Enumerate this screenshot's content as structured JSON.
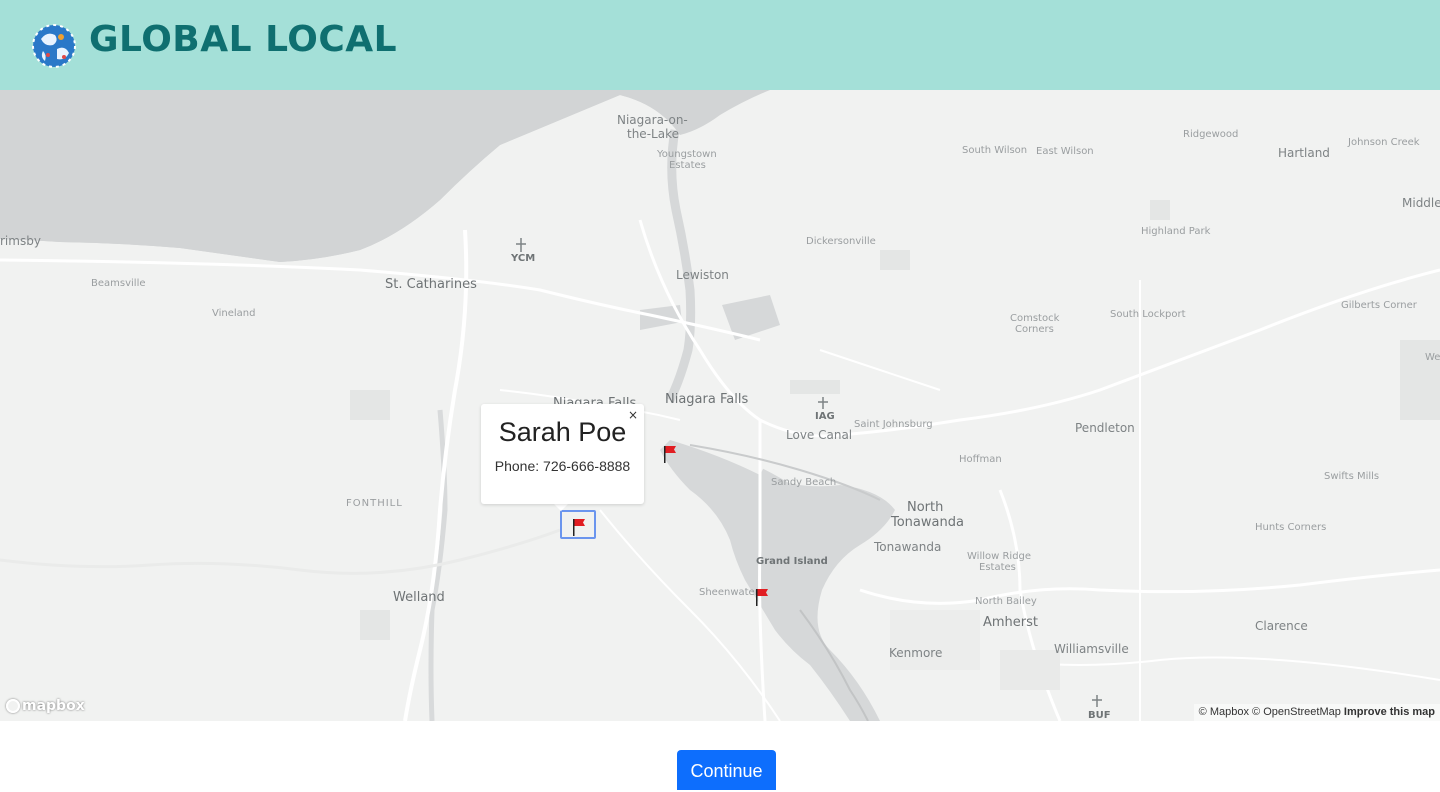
{
  "header": {
    "brand": "GLOBAL LOCAL",
    "logo_icon": "globe-icon",
    "background": "#a4e0d8",
    "brand_color": "#0f6f70"
  },
  "map": {
    "labels": {
      "grimsby": "rimsby",
      "beamsville": "Beamsville",
      "vineland": "Vineland",
      "st_catharines": "St. Catharines",
      "ycm": "YCM",
      "niagara_on_the_lake_1": "Niagara-on-",
      "niagara_on_the_lake_2": "the-Lake",
      "youngstown_1": "Youngstown",
      "youngstown_2": "Estates",
      "lewiston": "Lewiston",
      "niagara_falls_ca": "Niagara Falls",
      "niagara_falls_us": "Niagara Falls",
      "iag": "IAG",
      "love_canal": "Love Canal",
      "saint_johnsburg": "Saint Johnsburg",
      "fonthill": "FONTHILL",
      "welland": "Welland",
      "sandy_beach": "Sandy Beach",
      "grand_island": "Grand Island",
      "sheenwater": "Sheenwater",
      "north_tonawanda_1": "North",
      "north_tonawanda_2": "Tonawanda",
      "tonawanda": "Tonawanda",
      "kenmore": "Kenmore",
      "amherst": "Amherst",
      "williamsville": "Williamsville",
      "buf": "BUF",
      "north_bailey": "North Bailey",
      "willow_ridge_1": "Willow Ridge",
      "willow_ridge_2": "Estates",
      "hoffman": "Hoffman",
      "pendleton": "Pendleton",
      "clarence": "Clarence",
      "hunts_corners": "Hunts Corners",
      "swifts_mills": "Swifts Mills",
      "south_wilson": "South Wilson",
      "east_wilson": "East Wilson",
      "ridgewood": "Ridgewood",
      "hartland": "Hartland",
      "johnson_creek": "Johnson Creek",
      "middle": "Middle",
      "dickersonville": "Dickersonville",
      "highland_park": "Highland Park",
      "comstock_1": "Comstock",
      "comstock_2": "Corners",
      "south_lockport": "South Lockport",
      "gilberts_corner": "Gilberts Corner",
      "we": "We"
    },
    "popup": {
      "name": "Sarah Poe",
      "phone": "Phone: 726-666-8888",
      "close": "×"
    },
    "mapbox_logo": "mapbox",
    "attribution": {
      "mapbox": "© Mapbox",
      "osm": "© OpenStreetMap",
      "improve": "Improve this map"
    },
    "marker_icon": "flag-icon",
    "water_color": "#d2d4d5",
    "land_color": "#f1f2f1"
  },
  "footer": {
    "continue_label": "Continue",
    "button_color": "#0d6efd"
  }
}
